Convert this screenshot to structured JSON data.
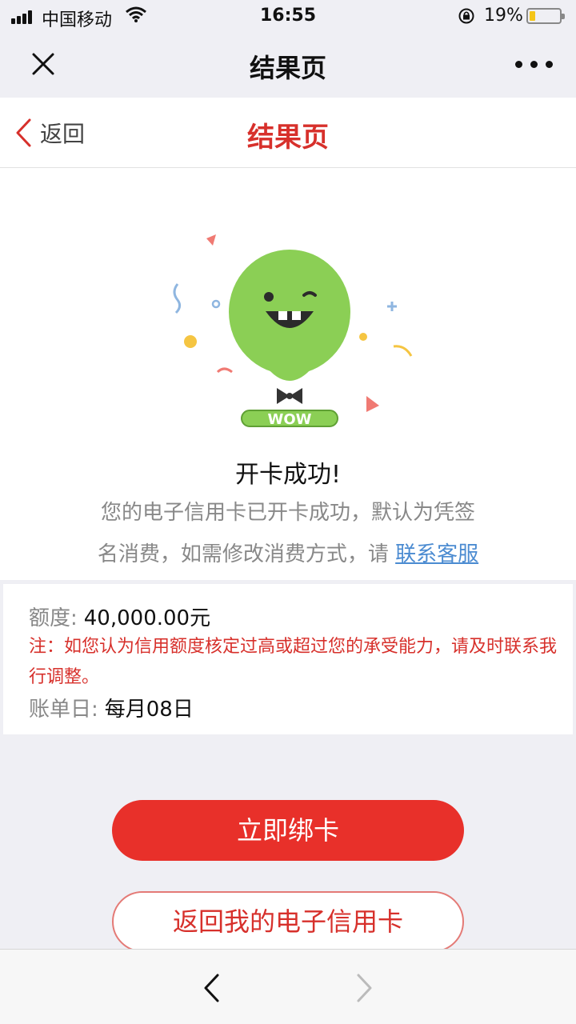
{
  "status_bar": {
    "carrier": "中国移动",
    "time": "16:55",
    "battery": "19%",
    "battery_level": 0.19,
    "icons": [
      "signal-icon",
      "wifi-icon",
      "orientation-lock-icon",
      "battery-icon"
    ]
  },
  "nav": {
    "title": "结果页",
    "icons": [
      "close-icon",
      "more-icon"
    ]
  },
  "header": {
    "back_label": "返回",
    "title": "结果页",
    "icons": [
      "chevron-left-icon"
    ]
  },
  "result": {
    "illustration_icon": "balloon-wow-icon",
    "wow_text": "WOW",
    "title": "开卡成功!",
    "desc_line1": "您的电子信用卡已开卡成功，默认为凭签",
    "desc_line2": "名消费，如需修改消费方式，请",
    "contact_link": "联系客服"
  },
  "info": {
    "limit_label": "额度:",
    "limit_value": "40,000.00元",
    "note": "注：如您认为信用额度核定过高或超过您的承受能力，请及时联系我行调整。",
    "bill_label": "账单日:",
    "bill_value": "每月08日"
  },
  "buttons": {
    "bind_card": "立即绑卡",
    "back_to_card": "返回我的电子信用卡"
  },
  "bottom_bar": {
    "icons": [
      "back-arrow-icon",
      "forward-arrow-icon"
    ]
  },
  "colors": {
    "accent_red": "#e8302a",
    "title_red": "#d7302b",
    "link_blue": "#4b8bd1",
    "balloon_green": "#8bcf55"
  }
}
